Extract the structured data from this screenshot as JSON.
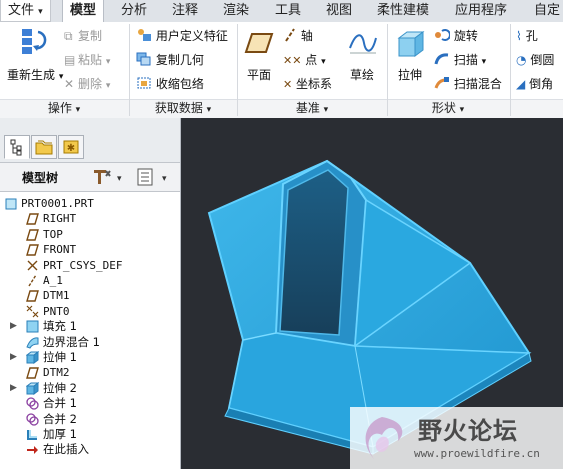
{
  "menu": {
    "file_label": "文件",
    "tabs": [
      "模型",
      "分析",
      "注释",
      "渲染",
      "工具",
      "视图",
      "柔性建模",
      "应用程序",
      "自定"
    ]
  },
  "ribbon": {
    "operations": {
      "regenerate": "重新生成",
      "copy": "复制",
      "paste": "粘贴",
      "delete": "删除",
      "group_label": "操作"
    },
    "get_data": {
      "udf": "用户定义特征",
      "copy_geometry": "复制几何",
      "shrinkwrap": "收缩包络",
      "group_label": "获取数据"
    },
    "datum": {
      "plane": "平面",
      "axis": "轴",
      "point": "点",
      "csys": "坐标系",
      "sketch": "草绘",
      "group_label": "基准"
    },
    "shapes": {
      "extrude": "拉伸",
      "revolve": "旋转",
      "sweep": "扫描",
      "swept_blend": "扫描混合",
      "group_label": "形状"
    },
    "engineering": {
      "hole": "孔",
      "round": "倒圆",
      "chamfer": "倒角"
    }
  },
  "model_tree": {
    "title": "模型树",
    "items": [
      {
        "label": "PRT0001.PRT",
        "icon": "part-icon",
        "expander": ""
      },
      {
        "label": "RIGHT",
        "icon": "datum-plane-icon",
        "expander": ""
      },
      {
        "label": "TOP",
        "icon": "datum-plane-icon",
        "expander": ""
      },
      {
        "label": "FRONT",
        "icon": "datum-plane-icon",
        "expander": ""
      },
      {
        "label": "PRT_CSYS_DEF",
        "icon": "csys-icon",
        "expander": ""
      },
      {
        "label": "A_1",
        "icon": "axis-icon",
        "expander": ""
      },
      {
        "label": "DTM1",
        "icon": "datum-plane-icon",
        "expander": ""
      },
      {
        "label": "PNT0",
        "icon": "datum-point-icon",
        "expander": ""
      },
      {
        "label": "填充 1",
        "icon": "fill-icon",
        "expander": "▶"
      },
      {
        "label": "边界混合 1",
        "icon": "boundary-blend-icon",
        "expander": ""
      },
      {
        "label": "拉伸 1",
        "icon": "extrude-icon",
        "expander": "▶"
      },
      {
        "label": "DTM2",
        "icon": "datum-plane-icon",
        "expander": ""
      },
      {
        "label": "拉伸 2",
        "icon": "extrude-icon",
        "expander": "▶"
      },
      {
        "label": "合并 1",
        "icon": "merge-icon",
        "expander": ""
      },
      {
        "label": "合并 2",
        "icon": "merge-icon",
        "expander": ""
      },
      {
        "label": "加厚 1",
        "icon": "thicken-icon",
        "expander": ""
      },
      {
        "label": "在此插入",
        "icon": "insert-here-arrow-icon",
        "expander": ""
      }
    ]
  },
  "watermark": {
    "title": "野火论坛",
    "url": "www.proewildfire.cn"
  },
  "colors": {
    "model_fill": "#2aa8e0",
    "model_edge": "#5fd0ff",
    "viewport_bg": "#2a2d33"
  }
}
